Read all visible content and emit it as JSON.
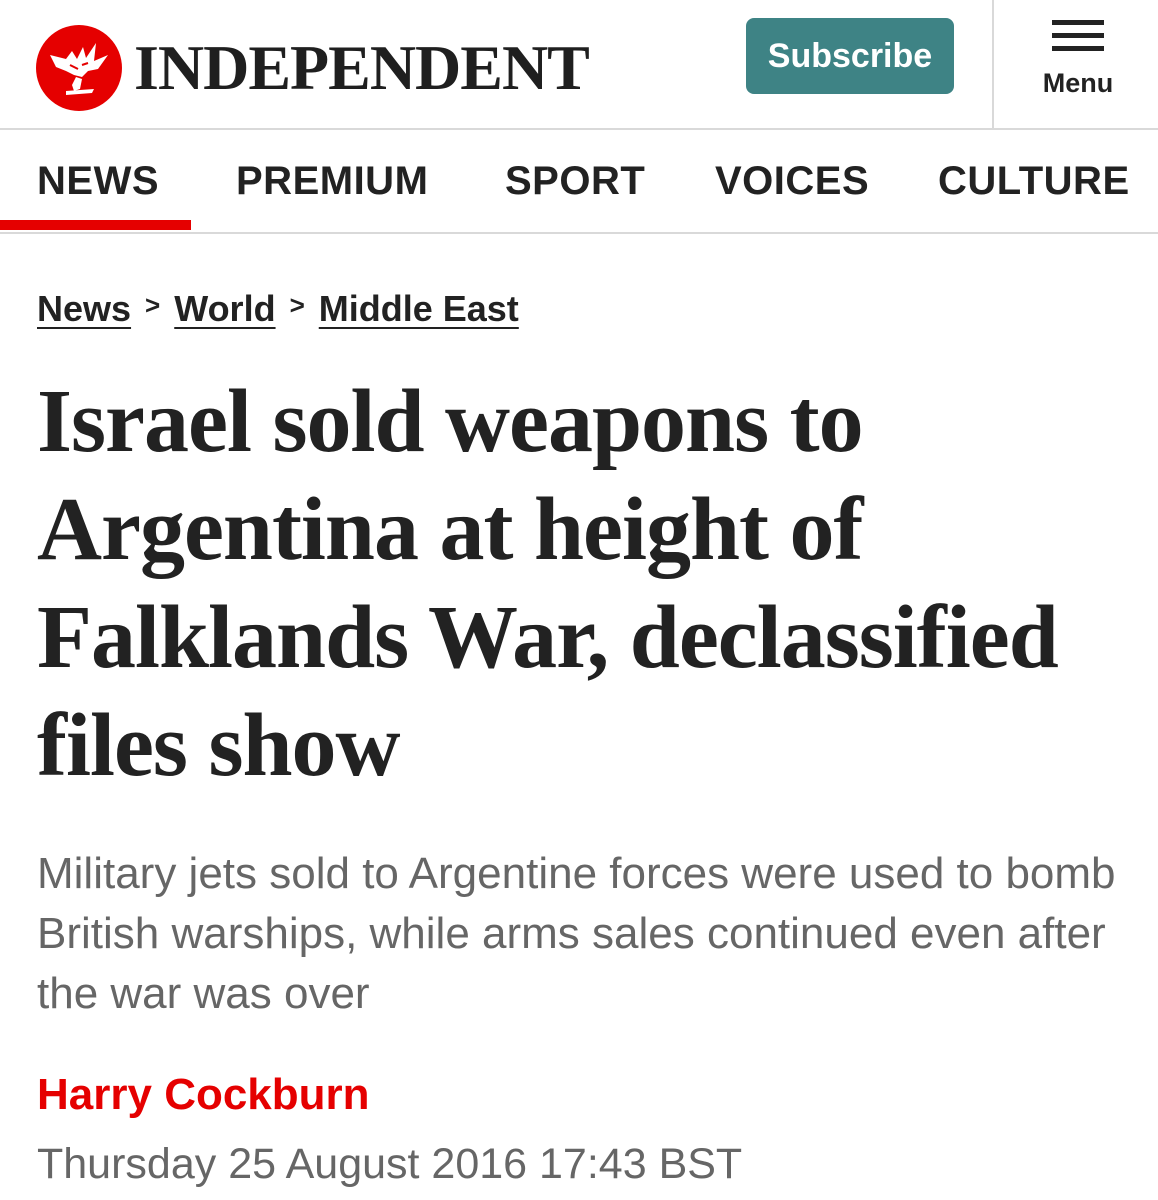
{
  "header": {
    "logo_text": "INDEPENDENT",
    "logo_icon": "eagle-icon",
    "subscribe_label": "Subscribe",
    "menu_label": "Menu",
    "menu_icon": "hamburger-icon"
  },
  "nav": {
    "items": [
      {
        "label": "NEWS",
        "active": true
      },
      {
        "label": "PREMIUM",
        "active": false
      },
      {
        "label": "SPORT",
        "active": false
      },
      {
        "label": "VOICES",
        "active": false
      },
      {
        "label": "CULTURE",
        "active": false
      }
    ]
  },
  "breadcrumb": {
    "items": [
      "News",
      "World",
      "Middle East"
    ],
    "separator": ">"
  },
  "article": {
    "headline": "Israel sold weapons to Argentina at height of Falklands War, declassified files show",
    "standfirst": "Military jets sold to Argentine forces were used to bomb British warships, while arms sales continued even after the war was over",
    "author": "Harry Cockburn",
    "date": "Thursday 25 August 2016 17:43 BST"
  },
  "colors": {
    "brand_red": "#e50000",
    "subscribe_teal": "#3e8385",
    "text_dark": "#222222",
    "text_grey": "#666666",
    "divider": "#d9d9d9"
  }
}
